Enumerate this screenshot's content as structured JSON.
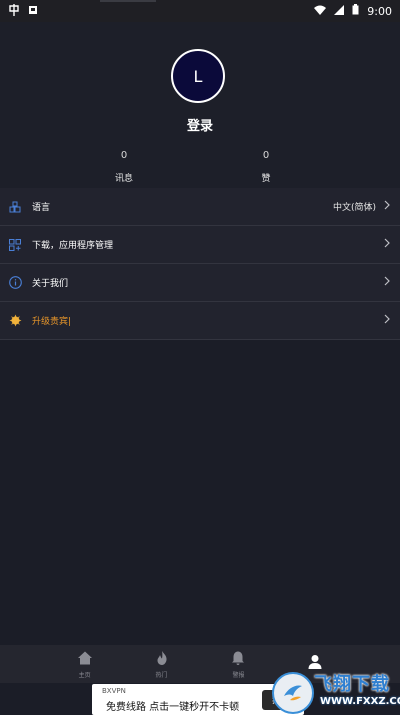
{
  "status_bar": {
    "time": "9:00"
  },
  "profile": {
    "avatar_initial": "L",
    "login_label": "登录",
    "messages_count": "0",
    "messages_label": "讯息",
    "likes_count": "0",
    "likes_label": "赞"
  },
  "menu": {
    "items": [
      {
        "label": "语言",
        "value": "中文(简体)",
        "icon": "language-icon"
      },
      {
        "label": "下载，应用程序管理",
        "value": "",
        "icon": "apps-grid-icon"
      },
      {
        "label": "关于我们",
        "value": "",
        "icon": "info-icon"
      },
      {
        "label": "升级贵宾|",
        "value": "",
        "icon": "vip-crown-icon"
      }
    ]
  },
  "bottom_nav": {
    "items": [
      {
        "label": "主页",
        "icon": "home-icon"
      },
      {
        "label": "热门",
        "icon": "flame-icon"
      },
      {
        "label": "警报",
        "icon": "bell-icon"
      },
      {
        "label": "",
        "icon": "user-icon"
      }
    ],
    "active_index": 3
  },
  "ad": {
    "brand": "BXVPN",
    "text": "免费线路 点击一键秒开不卡顿",
    "button": "打开"
  },
  "watermark": {
    "title": "飞翔下载",
    "subtitle": "WWW.FXXZ.COM"
  },
  "colors": {
    "background": "#1b1d27",
    "row_background": "#22232e",
    "avatar_fill": "#0b0a3a",
    "vip_accent": "#e8962a",
    "watermark_blue": "#2f7fd0"
  }
}
